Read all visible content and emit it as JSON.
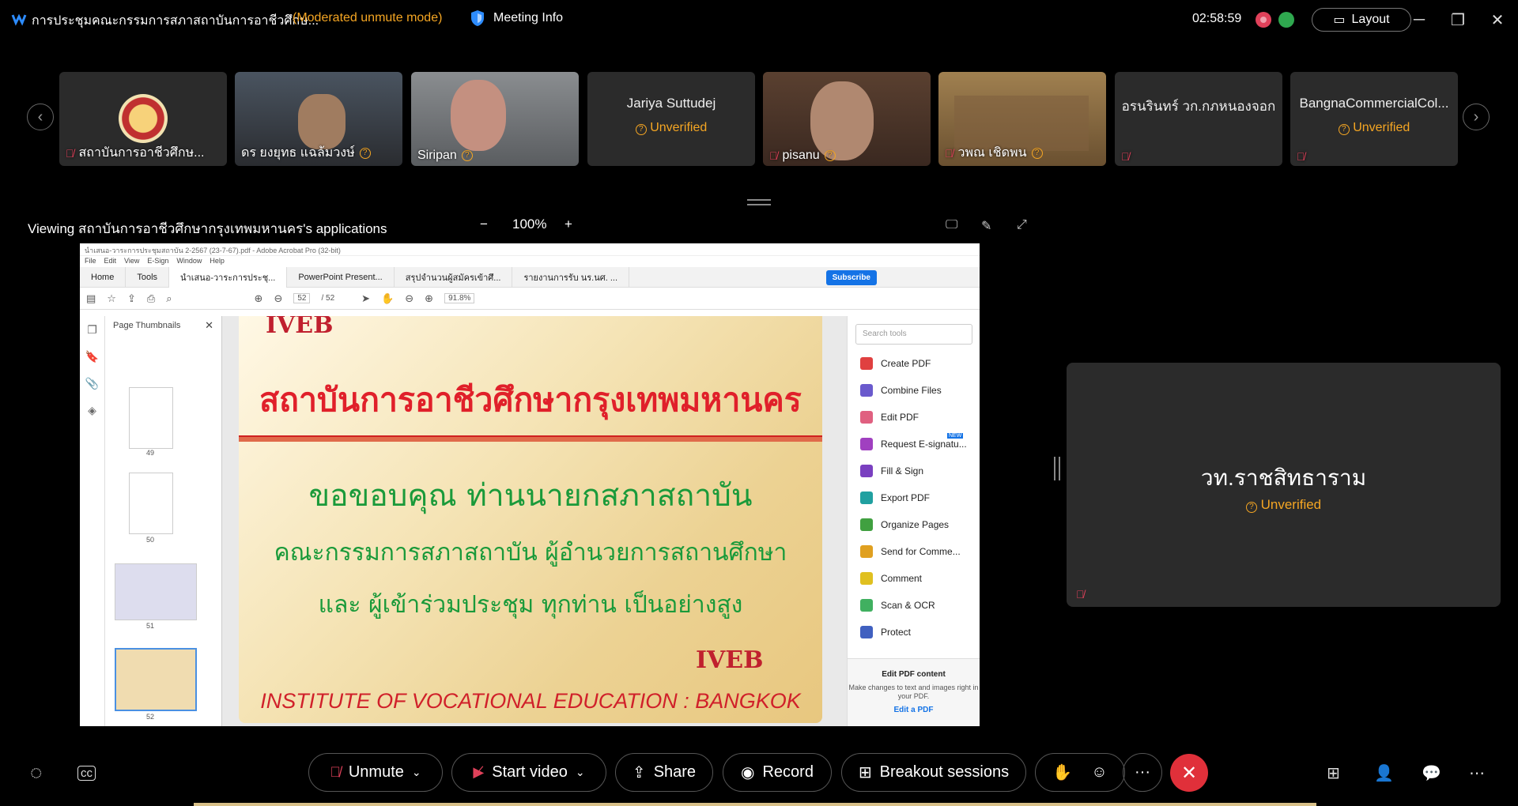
{
  "window": {
    "title": "การประชุมคณะกรรมการสภาสถาบันการอาชีวศึกษ...",
    "mode": "(Moderated unmute mode)",
    "meeting_info": "Meeting Info",
    "clock": "02:58:59",
    "layout": "Layout"
  },
  "participants": [
    {
      "name": "สถาบันการอาชีวศึกษ...",
      "type": "logo"
    },
    {
      "name": "ดร ยงยุทธ แฉล้มวงษ์",
      "type": "video"
    },
    {
      "name": "Siripan",
      "type": "video"
    },
    {
      "name": "Jariya Suttudej",
      "type": "name",
      "status": "Unverified"
    },
    {
      "name": "pisanu",
      "type": "video"
    },
    {
      "name": "วพณ เชิดพน",
      "type": "video"
    },
    {
      "name": "อรนรินทร์ วก.กภหนองจอก",
      "type": "name"
    },
    {
      "name": "BangnaCommercialCol...",
      "type": "name",
      "status": "Unverified"
    }
  ],
  "share": {
    "viewing": "Viewing สถาบันการอาชีวศึกษากรุงเทพมหานคร's applications",
    "zoom": "100%",
    "acrobat": {
      "title": "นำเสนอ-วาระการประชุมสถาบัน 2-2567 (23-7-67).pdf - Adobe Acrobat Pro (32-bit)",
      "menu": [
        "File",
        "Edit",
        "View",
        "E-Sign",
        "Window",
        "Help"
      ],
      "tabs": [
        "Home",
        "Tools",
        "นำเสนอ-วาระการประชุ...",
        "PowerPoint Present...",
        "สรุปจำนวนผู้สมัครเข้าศึ...",
        "รายงานการรับ นร.นศ. ..."
      ],
      "subscribe": "Subscribe",
      "page_current": "52",
      "page_total": "/ 52",
      "zoom": "91.8%",
      "thumbs_header": "Page Thumbnails",
      "thumb_pages": [
        "49",
        "50",
        "51",
        "52"
      ],
      "search_tools": "Search tools",
      "tools": [
        "Create PDF",
        "Combine Files",
        "Edit PDF",
        "Request E-signatu...",
        "Fill & Sign",
        "Export PDF",
        "Organize Pages",
        "Send for Comme...",
        "Comment",
        "Scan & OCR",
        "Protect"
      ],
      "new_badge": "NEW",
      "edit_box_title": "Edit PDF content",
      "edit_box_text": "Make changes to text and images right in your PDF.",
      "edit_box_link": "Edit a PDF"
    },
    "slide": {
      "logo": "IVEB",
      "title": "สถาบันการอาชีวศึกษากรุงเทพมหานคร",
      "line1": "ขอขอบคุณ ท่านนายกสภาสถาบัน",
      "line2": "คณะกรรมการสภาสถาบัน ผู้อำนวยการสถานศึกษา",
      "line3": "และ ผู้เข้าร่วมประชุม ทุกท่าน เป็นอย่างสูง",
      "logo2": "IVEB",
      "english": "INSTITUTE OF VOCATIONAL EDUCATION : BANGKOK"
    }
  },
  "active_speaker": {
    "name": "วท.ราชสิทธาราม",
    "status": "Unverified"
  },
  "controls": {
    "unmute": "Unmute",
    "start_video": "Start video",
    "share": "Share",
    "record": "Record",
    "breakout": "Breakout sessions",
    "more": "···"
  },
  "colors": {
    "accent": "#f5a623",
    "danger": "#e0303a"
  }
}
